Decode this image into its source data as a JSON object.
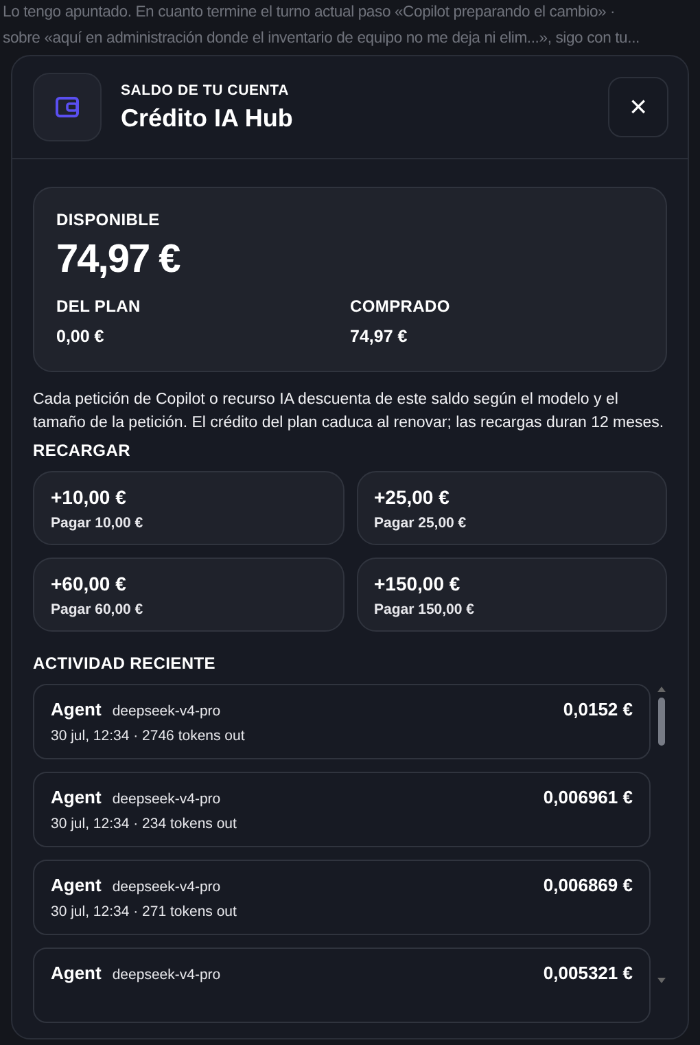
{
  "background_chat": {
    "lines": [
      "Lo tengo apuntado. En cuanto termine el turno actual paso «Copilot preparando el cambio» ·",
      "sobre «aquí en administración donde el inventario de equipo no me deja ni elim...», sigo con tu..."
    ]
  },
  "dialog": {
    "eyebrow": "SALDO DE TU CUENTA",
    "title": "Crédito IA Hub",
    "close": "×"
  },
  "balance": {
    "label": "DISPONIBLE",
    "amount": "74,97 €",
    "parts": [
      {
        "label": "DEL PLAN",
        "value": "0,00 €"
      },
      {
        "label": "COMPRADO",
        "value": "74,97 €"
      }
    ]
  },
  "description": "Cada petición de Copilot o recurso IA descuenta de este saldo según el modelo y el tamaño de la petición. El crédito del plan caduca al renovar; las recargas duran 12 meses.",
  "recharge": {
    "heading": "RECARGAR",
    "options": [
      {
        "amount": "+10,00 €",
        "pay": "Pagar 10,00 €"
      },
      {
        "amount": "+25,00 €",
        "pay": "Pagar 25,00 €"
      },
      {
        "amount": "+60,00 €",
        "pay": "Pagar 60,00 €"
      },
      {
        "amount": "+150,00 €",
        "pay": "Pagar 150,00 €"
      }
    ]
  },
  "activity": {
    "heading": "ACTIVIDAD RECIENTE",
    "items": [
      {
        "agent": "Agent",
        "model": "deepseek-v4-pro",
        "meta": "30 jul, 12:34 · 2746 tokens out",
        "cost": "0,0152 €"
      },
      {
        "agent": "Agent",
        "model": "deepseek-v4-pro",
        "meta": "30 jul, 12:34 · 234 tokens out",
        "cost": "0,006961 €"
      },
      {
        "agent": "Agent",
        "model": "deepseek-v4-pro",
        "meta": "30 jul, 12:34 · 271 tokens out",
        "cost": "0,006869 €"
      },
      {
        "agent": "Agent",
        "model": "deepseek-v4-pro",
        "cost": "0,005321 €"
      }
    ]
  }
}
